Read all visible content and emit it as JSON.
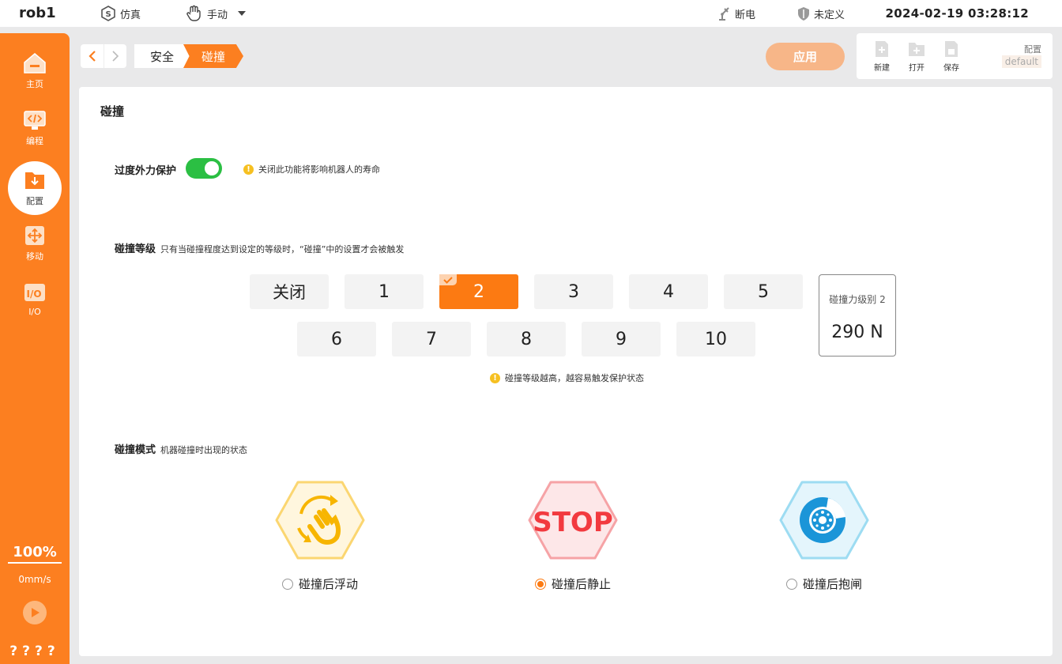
{
  "topbar": {
    "robot_name": "rob1",
    "simulation_label": "仿真",
    "mode_label": "手动",
    "power_label": "断电",
    "safety_label": "未定义",
    "datetime": "2024-02-19 03:28:12"
  },
  "sidebar": {
    "items": [
      {
        "label": "主页",
        "icon": "home-icon"
      },
      {
        "label": "编程",
        "icon": "code-icon"
      },
      {
        "label": "配置",
        "icon": "config-icon",
        "active": true
      },
      {
        "label": "移动",
        "icon": "move-icon"
      },
      {
        "label": "I/O",
        "icon": "io-icon"
      }
    ],
    "speed_percent": "100%",
    "speed_value": "0mm/s",
    "status_marks": "????"
  },
  "breadcrumb": {
    "parent": "安全",
    "current": "碰撞"
  },
  "toolbar": {
    "apply_label": "应用",
    "new_label": "新建",
    "open_label": "打开",
    "save_label": "保存",
    "config_label": "配置",
    "config_value": "default"
  },
  "content": {
    "title": "碰撞",
    "protection": {
      "label": "过度外力保护",
      "enabled": true,
      "warning": "关闭此功能将影响机器人的寿命"
    },
    "level": {
      "label": "碰撞等级",
      "description": "只有当碰撞程度达到设定的等级时，“碰撞”中的设置才会被触发",
      "options": [
        "关闭",
        "1",
        "2",
        "3",
        "4",
        "5",
        "6",
        "7",
        "8",
        "9",
        "10"
      ],
      "selected": "2",
      "warning": "碰撞等级越高，越容易触发保护状态",
      "force_label": "碰撞力级别 2",
      "force_value": "290 N"
    },
    "mode": {
      "label": "碰撞模式",
      "description": "机器碰撞时出现的状态",
      "stop_text": "STOP",
      "options": [
        {
          "label": "碰撞后浮动",
          "selected": false
        },
        {
          "label": "碰撞后静止",
          "selected": true
        },
        {
          "label": "碰撞后抱闸",
          "selected": false
        }
      ]
    }
  },
  "colors": {
    "accent": "#fc7f20",
    "toggle_on": "#2bbf43",
    "warning": "#f6c021"
  }
}
